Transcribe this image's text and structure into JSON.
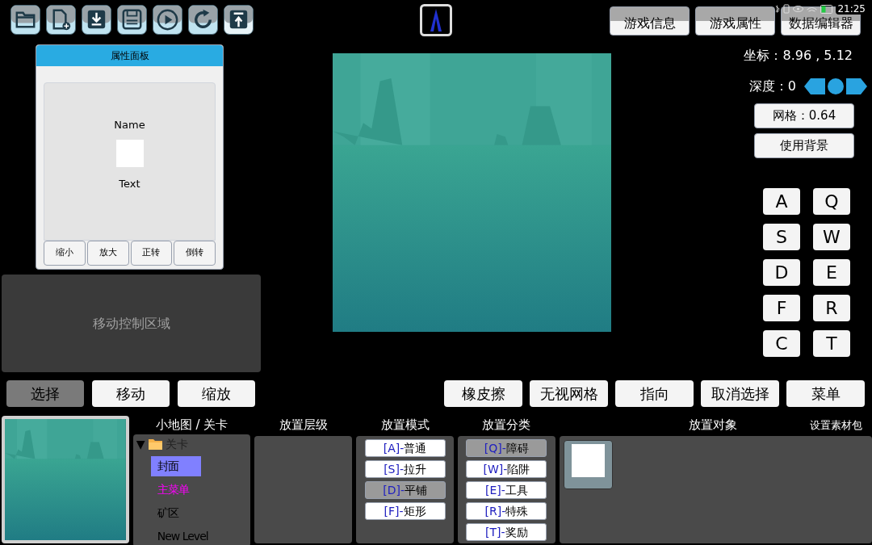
{
  "status_bar": {
    "time": "21:25"
  },
  "property_panel": {
    "title": "属性面板",
    "name": "Name",
    "text": "Text",
    "buttons": [
      "缩小",
      "放大",
      "正转",
      "倒转"
    ]
  },
  "move_area": {
    "label": "移动控制区域"
  },
  "top_buttons": [
    "游戏信息",
    "游戏属性",
    "数据编辑器"
  ],
  "coordinates": "坐标：8.96 , 5.12",
  "depth": "深度：0",
  "grid_button": "网格：0.64",
  "background_button": "使用背景",
  "keys": [
    "A",
    "Q",
    "S",
    "W",
    "D",
    "E",
    "F",
    "R",
    "C",
    "T"
  ],
  "tool_buttons": [
    {
      "label": "选择",
      "selected": true
    },
    {
      "label": "移动",
      "selected": false
    },
    {
      "label": "缩放",
      "selected": false
    }
  ],
  "action_buttons": [
    "橡皮擦",
    "无视网格",
    "指向",
    "取消选择",
    "菜单"
  ],
  "levels": {
    "header": "小地图 / 关卡",
    "tree": {
      "toggle": "▼",
      "label": "关卡",
      "expanded": true,
      "children": [
        {
          "label": "封面",
          "selected": true,
          "color": "#000000"
        },
        {
          "label": "主菜单",
          "selected": false,
          "color": "#ff00ff"
        },
        {
          "label": "矿区",
          "selected": false,
          "color": "#000000"
        },
        {
          "label": "New Level",
          "selected": false,
          "color": "#000000"
        }
      ]
    }
  },
  "layers": {
    "header": "放置层级"
  },
  "modes": {
    "header": "放置模式",
    "items": [
      {
        "key": "[A]-",
        "label": "普通",
        "selected": false
      },
      {
        "key": "[S]-",
        "label": "拉升",
        "selected": false
      },
      {
        "key": "[D]-",
        "label": "平铺",
        "selected": true
      },
      {
        "key": "[F]-",
        "label": "矩形",
        "selected": false
      }
    ]
  },
  "categories": {
    "header": "放置分类",
    "items": [
      {
        "key": "[Q]-",
        "label": "障碍",
        "selected": true
      },
      {
        "key": "[W]-",
        "label": "陷阱",
        "selected": false
      },
      {
        "key": "[E]-",
        "label": "工具",
        "selected": false
      },
      {
        "key": "[R]-",
        "label": "特殊",
        "selected": false
      },
      {
        "key": "[T]-",
        "label": "奖励",
        "selected": false
      }
    ]
  },
  "objects": {
    "header": "放置对象",
    "asset_pack": "设置素材包"
  }
}
